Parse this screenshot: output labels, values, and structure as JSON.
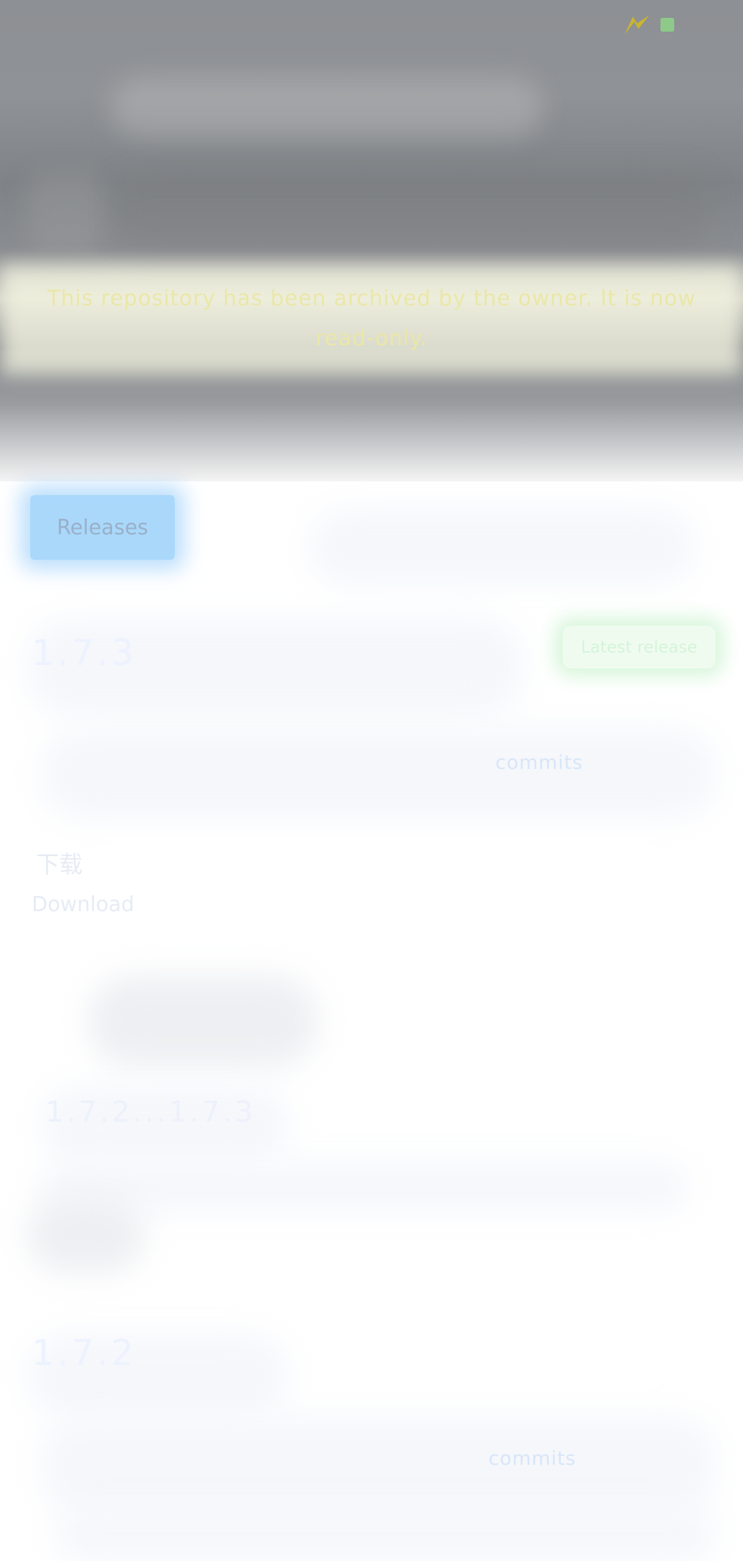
{
  "colors": {
    "header_bg": "#8d9094",
    "archived_text": "#eae7a8",
    "tab_bg": "#a9d8fb",
    "latest_badge_bg": "#f0fbf0",
    "status_square": "#8ec98a"
  },
  "status_bar": {
    "icons": [
      "lightning-bolt-icon",
      "green-square-icon"
    ]
  },
  "archived_notice": {
    "text": "This repository has been archived by the owner. It is now read-only."
  },
  "tabs": {
    "releases": "Releases"
  },
  "releases": [
    {
      "version": "1.7.3",
      "badge": "Latest release",
      "commits_label": "commits"
    },
    {
      "version": "1.7.2",
      "commits_label": "commits"
    }
  ],
  "download": {
    "title": "下载",
    "subtitle": "Download"
  },
  "compare": {
    "label": "1.7.2...1.7.3"
  }
}
